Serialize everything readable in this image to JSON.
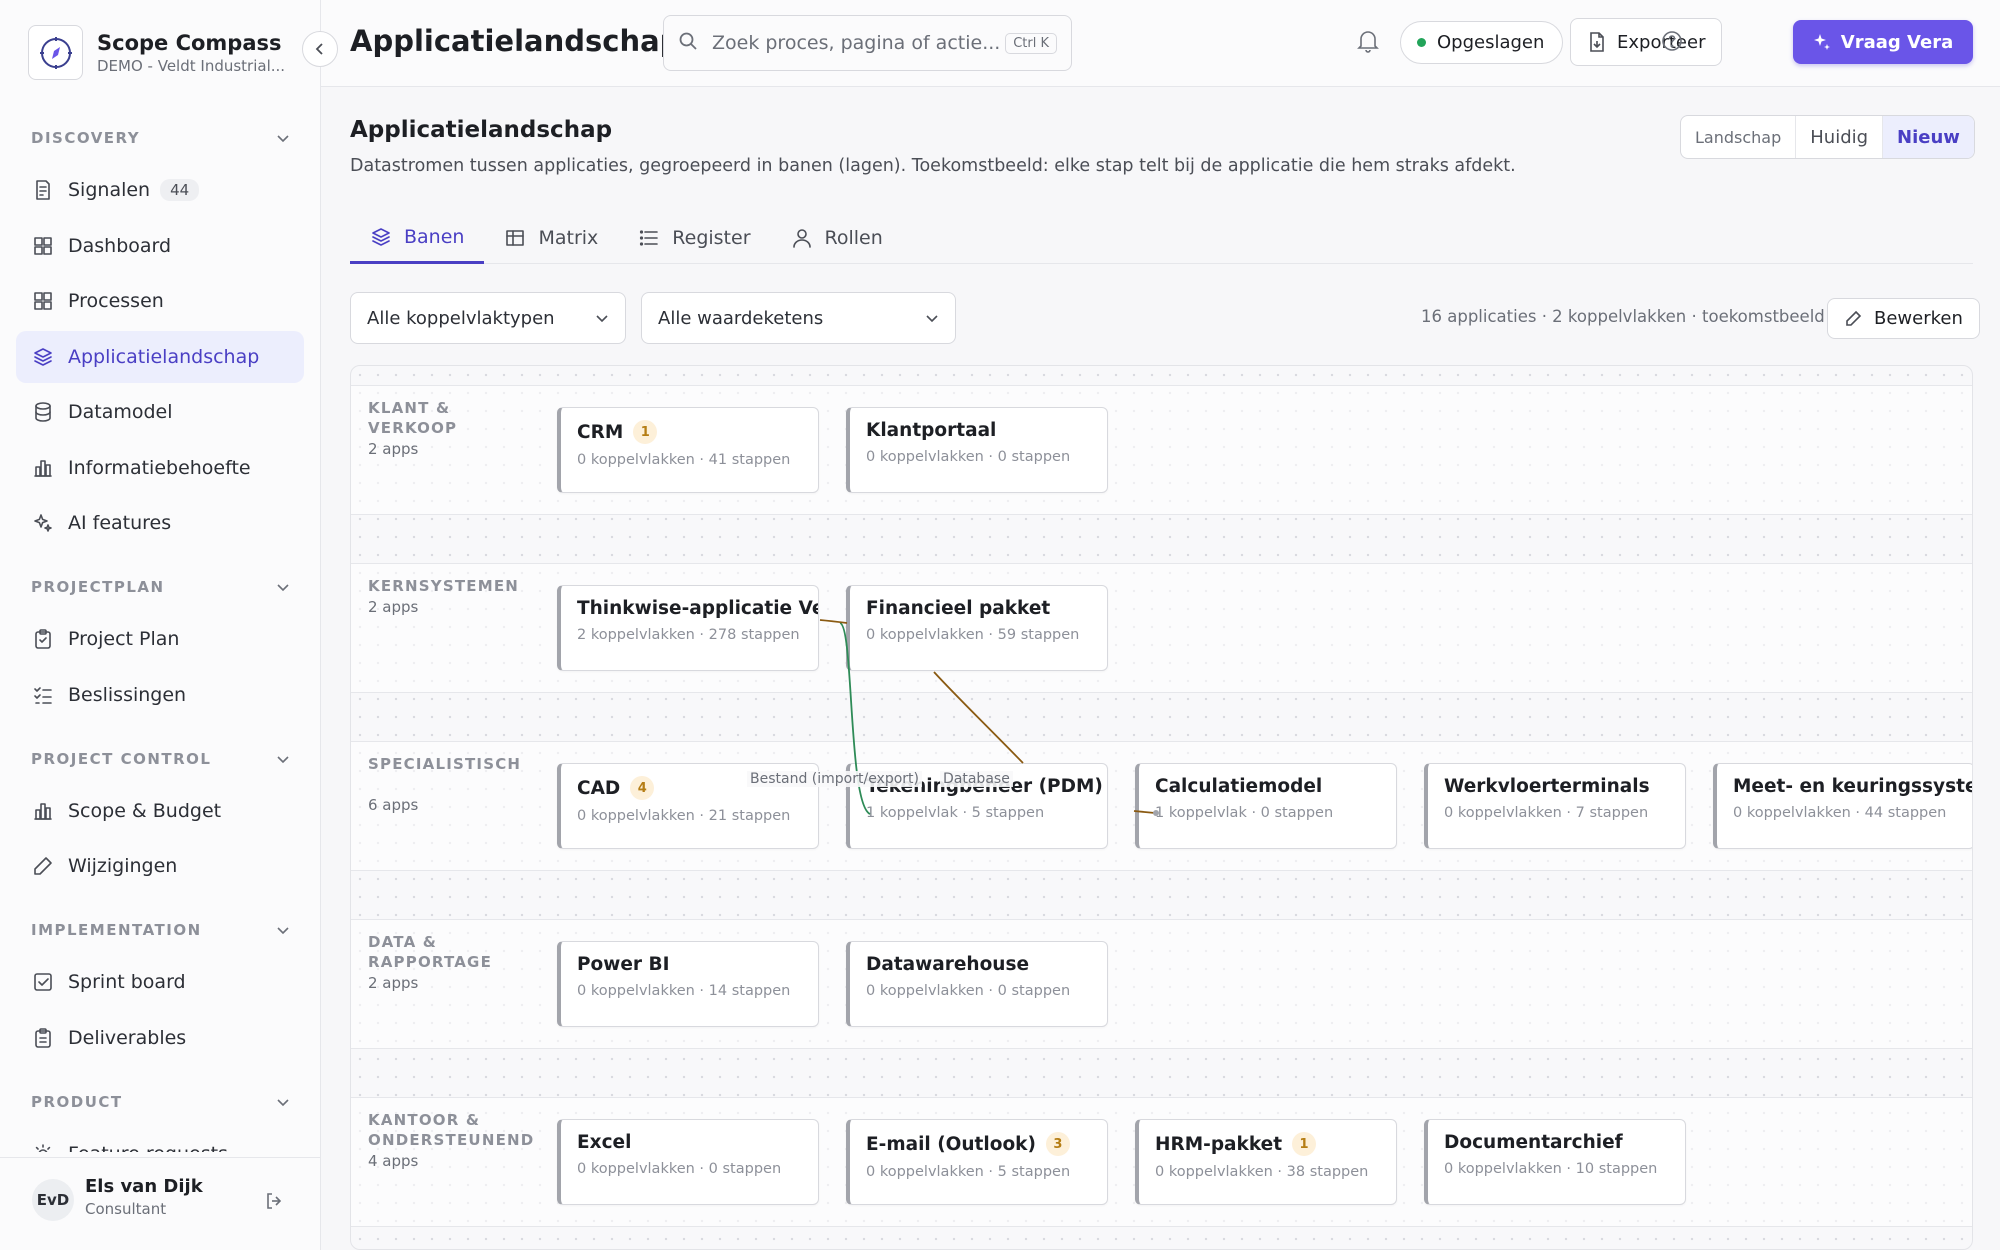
{
  "sidebar": {
    "brand_name": "Scope Compass",
    "brand_sub": "DEMO - Veldt Industrial...",
    "sections": [
      {
        "label": "DISCOVERY",
        "items": [
          {
            "label": "Signalen",
            "badge": "44",
            "icon": "signal-doc-icon"
          },
          {
            "label": "Dashboard",
            "icon": "dashboard-icon"
          },
          {
            "label": "Processen",
            "icon": "processes-icon"
          },
          {
            "label": "Applicatielandschap",
            "icon": "layers-icon",
            "active": true
          },
          {
            "label": "Datamodel",
            "icon": "database-icon"
          },
          {
            "label": "Informatiebehoefte",
            "icon": "bar-chart-icon"
          },
          {
            "label": "AI features",
            "icon": "sparkle-icon"
          }
        ]
      },
      {
        "label": "PROJECTPLAN",
        "items": [
          {
            "label": "Project Plan",
            "icon": "clipboard-icon"
          },
          {
            "label": "Beslissingen",
            "icon": "checklist-icon"
          }
        ]
      },
      {
        "label": "PROJECT CONTROL",
        "items": [
          {
            "label": "Scope & Budget",
            "icon": "bar-chart-icon"
          },
          {
            "label": "Wijzigingen",
            "icon": "pencil-icon"
          }
        ]
      },
      {
        "label": "IMPLEMENTATION",
        "items": [
          {
            "label": "Sprint board",
            "icon": "checkbox-icon"
          },
          {
            "label": "Deliverables",
            "icon": "clipboard-list-icon"
          }
        ]
      },
      {
        "label": "PRODUCT",
        "items": [
          {
            "label": "Feature requests",
            "icon": "bulb-icon"
          }
        ]
      }
    ],
    "user": {
      "initials": "EvD",
      "name": "Els van Dijk",
      "role": "Consultant"
    }
  },
  "topbar": {
    "title": "Applicatielandschap",
    "search_placeholder": "Zoek proces, pagina of actie...",
    "search_shortcut": "Ctrl K",
    "saved_label": "Opgeslagen",
    "export_label": "Exporteer",
    "ask_label": "Vraag Vera"
  },
  "page": {
    "title": "Applicatielandschap",
    "description": "Datastromen tussen applicaties, gegroepeerd in banen (lagen). Toekomstbeeld: elke stap telt bij de applicatie die hem straks afdekt.",
    "view_toggle": {
      "label": "Landschap",
      "options": [
        "Huidig",
        "Nieuw"
      ],
      "selected": "Nieuw"
    },
    "tabs": [
      {
        "label": "Banen",
        "icon": "layers-icon",
        "active": true
      },
      {
        "label": "Matrix",
        "icon": "table-icon"
      },
      {
        "label": "Register",
        "icon": "list-icon"
      },
      {
        "label": "Rollen",
        "icon": "user-icon"
      }
    ],
    "filters": {
      "interface_type": "Alle koppelvlaktypen",
      "value_chain": "Alle waardeketens"
    },
    "summary": "16 applicaties · 2 koppelvlakken · toekomstbeeld",
    "edit_label": "Bewerken"
  },
  "lanes": [
    {
      "label": "KLANT & VERKOOP",
      "count": "2 apps",
      "apps": [
        {
          "name": "CRM",
          "badge": "1",
          "meta": "0 koppelvlakken · 41 stappen"
        },
        {
          "name": "Klantportaal",
          "meta": "0 koppelvlakken · 0 stappen"
        }
      ]
    },
    {
      "label": "KERNSYSTEMEN",
      "count": "2 apps",
      "apps": [
        {
          "name": "Thinkwise-applicatie Ve",
          "meta": "2 koppelvlakken · 278 stappen"
        },
        {
          "name": "Financieel pakket",
          "meta": "0 koppelvlakken · 59 stappen"
        }
      ]
    },
    {
      "label": "SPECIALISTISCH",
      "count": "6 apps",
      "apps": [
        {
          "name": "CAD",
          "badge": "4",
          "meta": "0 koppelvlakken · 21 stappen"
        },
        {
          "name": "Tekeningbeheer (PDM)",
          "meta": "1 koppelvlak · 5 stappen"
        },
        {
          "name": "Calculatiemodel",
          "meta": "1 koppelvlak · 0 stappen"
        },
        {
          "name": "Werkvloerterminals",
          "meta": "0 koppelvlakken · 7 stappen"
        },
        {
          "name": "Meet- en keuringssyste",
          "meta": "0 koppelvlakken · 44 stappen"
        }
      ]
    },
    {
      "label": "DATA & RAPPORTAGE",
      "count": "2 apps",
      "apps": [
        {
          "name": "Power BI",
          "meta": "0 koppelvlakken · 14 stappen"
        },
        {
          "name": "Datawarehouse",
          "meta": "0 koppelvlakken · 0 stappen"
        }
      ]
    },
    {
      "label": "KANTOOR & ONDERSTEUNEND",
      "count": "4 apps",
      "apps": [
        {
          "name": "Excel",
          "meta": "0 koppelvlakken · 0 stappen"
        },
        {
          "name": "E-mail (Outlook)",
          "badge": "3",
          "meta": "0 koppelvlakken · 5 stappen"
        },
        {
          "name": "HRM-pakket",
          "badge": "1",
          "meta": "0 koppelvlakken · 38 stappen"
        },
        {
          "name": "Documentarchief",
          "meta": "0 koppelvlakken · 10 stappen"
        }
      ]
    }
  ],
  "interfaces": [
    {
      "label": "Bestand (import/export)",
      "color": "#2e8b57"
    },
    {
      "label": "Database",
      "color": "#8a5a12"
    }
  ],
  "colors": {
    "accent": "#4a3fc4",
    "primary_button": "#6a55e8",
    "saved_dot": "#22a45a",
    "badge_bg": "#fdf0d9"
  }
}
